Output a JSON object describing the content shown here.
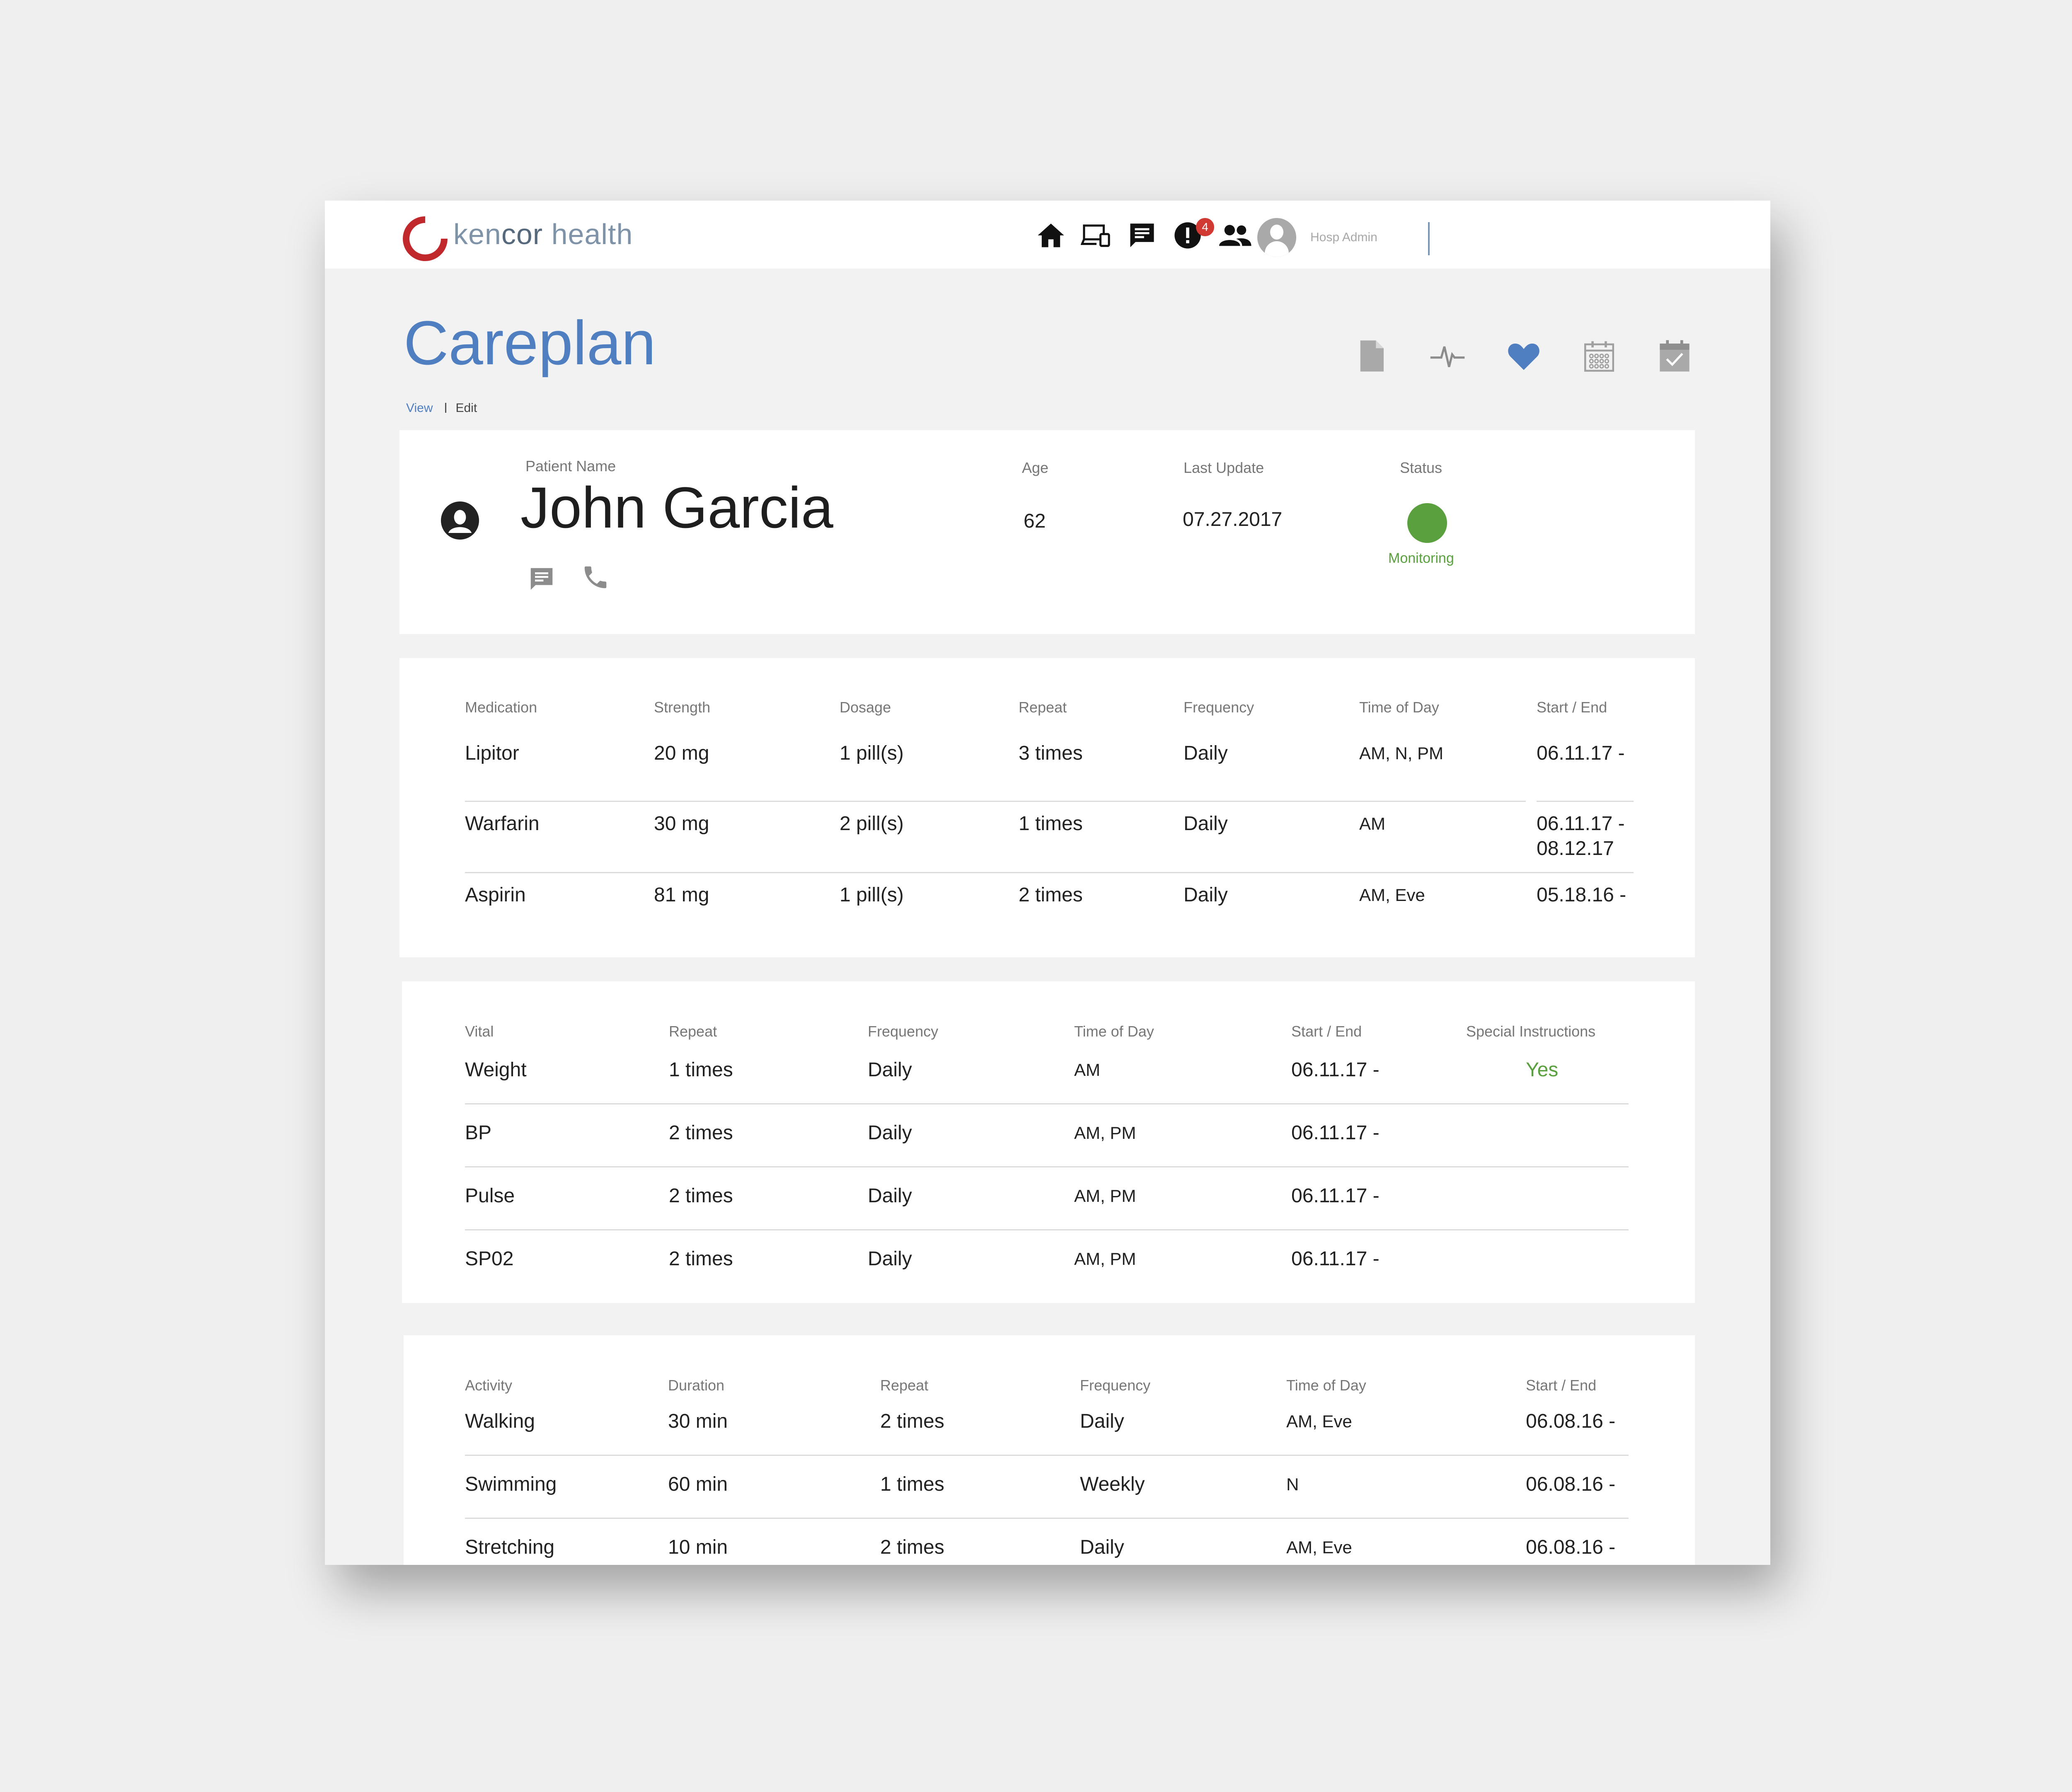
{
  "header": {
    "brand_part1": "ken",
    "brand_part2": "cor",
    "brand_part3": " health",
    "user_name": "Hosp Admin",
    "alert_count": "4"
  },
  "page": {
    "title": "Careplan",
    "view_label": "View",
    "edit_label": "Edit"
  },
  "patient": {
    "name_label": "Patient Name",
    "name": "John Garcia",
    "age_label": "Age",
    "age": "62",
    "last_update_label": "Last Update",
    "last_update": "07.27.2017",
    "status_label": "Status",
    "status": "Monitoring"
  },
  "medications": {
    "headers": [
      "Medication",
      "Strength",
      "Dosage",
      "Repeat",
      "Frequency",
      "Time of Day",
      "Start / End"
    ],
    "rows": [
      [
        "Lipitor",
        "20 mg",
        "1 pill(s)",
        "3 times",
        "Daily",
        "AM, N, PM",
        "06.11.17 -",
        ""
      ],
      [
        "Warfarin",
        "30 mg",
        "2 pill(s)",
        "1 times",
        "Daily",
        "AM",
        "06.11.17 -",
        "08.12.17"
      ],
      [
        "Aspirin",
        "81 mg",
        "1 pill(s)",
        "2 times",
        "Daily",
        "AM, Eve",
        "05.18.16 -",
        ""
      ]
    ]
  },
  "vitals": {
    "headers": [
      "Vital",
      "Repeat",
      "Frequency",
      "Time of Day",
      "Start / End",
      "Special Instructions"
    ],
    "rows": [
      [
        "Weight",
        "1 times",
        "Daily",
        "AM",
        "06.11.17 -",
        "Yes"
      ],
      [
        "BP",
        "2 times",
        "Daily",
        "AM, PM",
        "06.11.17 -",
        ""
      ],
      [
        "Pulse",
        "2 times",
        "Daily",
        "AM, PM",
        "06.11.17 -",
        ""
      ],
      [
        "SP02",
        "2 times",
        "Daily",
        "AM, PM",
        "06.11.17 -",
        ""
      ]
    ]
  },
  "activities": {
    "headers": [
      "Activity",
      "Duration",
      "Repeat",
      "Frequency",
      "Time of Day",
      "Start / End"
    ],
    "rows": [
      [
        "Walking",
        "30 min",
        "2 times",
        "Daily",
        "AM, Eve",
        "06.08.16 -"
      ],
      [
        "Swimming",
        "60 min",
        "1 times",
        "Weekly",
        "N",
        "06.08.16 -"
      ],
      [
        "Stretching",
        "10 min",
        "2 times",
        "Daily",
        "AM, Eve",
        "06.08.16 -"
      ]
    ]
  },
  "colors": {
    "brand_red": "#c0282c",
    "accent_blue": "#4f7fc0",
    "status_green": "#5aa03e"
  }
}
